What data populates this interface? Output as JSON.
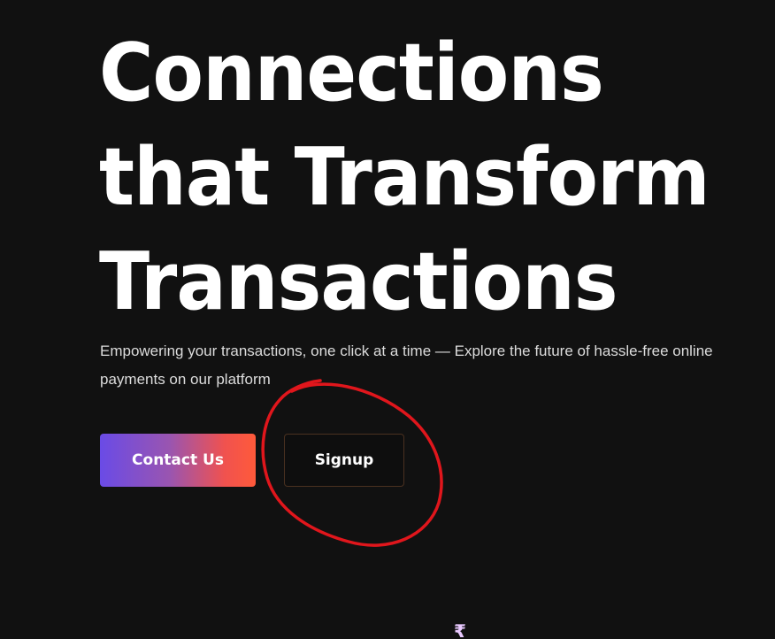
{
  "hero": {
    "title_lines": [
      "Connections",
      "that Transform",
      "Transactions"
    ],
    "subtitle": "Empowering your transactions, one click at a time — Explore the future of hassle-free online payments on our platform"
  },
  "buttons": {
    "contact_label": "Contact Us",
    "signup_label": "Signup"
  },
  "colors": {
    "background": "#111111",
    "text": "#ffffff",
    "gradient_start": "#6a4be6",
    "gradient_end": "#ff5a3a",
    "signup_border": "#4a3120",
    "annotation": "#e0161c"
  },
  "icons": {
    "bottom_glyph": "rupee-icon"
  }
}
